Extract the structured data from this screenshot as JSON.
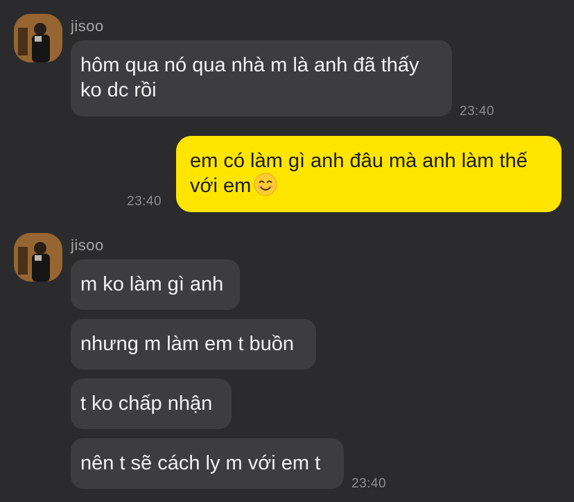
{
  "messages": [
    {
      "sender": "jisoo",
      "bubbles": [
        {
          "lines": [
            "hôm qua nó qua nhà m là anh đã thấy",
            "ko dc rồi"
          ]
        }
      ],
      "time": "23:40"
    },
    {
      "outgoing": true,
      "lines": [
        "em có làm gì anh đâu mà anh làm thế",
        "với em"
      ],
      "emoji": "smiling-face-emoji",
      "time": "23:40"
    },
    {
      "sender": "jisoo",
      "bubbles": [
        {
          "text": "m ko làm gì anh"
        },
        {
          "text": "nhưng m làm em t buồn"
        },
        {
          "text": "t ko chấp nhận"
        },
        {
          "text": "nên t sẽ cách ly m với em t"
        }
      ],
      "time": "23:40"
    }
  ],
  "colors": {
    "background": "#2b2b2d",
    "incoming_bubble": "#3d3d40",
    "outgoing_bubble": "#fee500",
    "timestamp": "#8c8c8e"
  }
}
